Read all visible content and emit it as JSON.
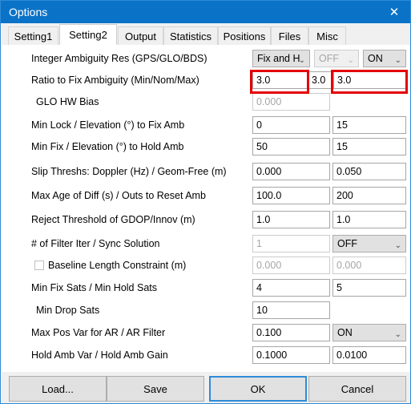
{
  "window": {
    "title": "Options",
    "close_icon": "close-icon"
  },
  "tabs": [
    {
      "label": "Setting1",
      "active": false
    },
    {
      "label": "Setting2",
      "active": true
    },
    {
      "label": "Output",
      "active": false
    },
    {
      "label": "Statistics",
      "active": false
    },
    {
      "label": "Positions",
      "active": false
    },
    {
      "label": "Files",
      "active": false
    },
    {
      "label": "Misc",
      "active": false
    }
  ],
  "settings": {
    "integer_ambiguity_res": {
      "label": "Integer Ambiguity Res (GPS/GLO/BDS)",
      "gps": "Fix and H",
      "glo": "OFF",
      "bds": "ON"
    },
    "ratio_to_fix": {
      "label": "Ratio to Fix Ambiguity (Min/Nom/Max)",
      "min": "3.0",
      "nom": "3.0",
      "max": "3.0"
    },
    "glo_hw_bias": {
      "label": "GLO HW Bias",
      "value": "0.000"
    },
    "min_lock_elev_fix": {
      "label": "Min Lock / Elevation (°) to Fix Amb",
      "min_lock": "0",
      "elevation": "15"
    },
    "min_fix_elev_hold": {
      "label": "Min Fix / Elevation (°) to Hold Amb",
      "min_fix": "50",
      "elevation": "15"
    },
    "slip_threshs": {
      "label": "Slip Threshs: Doppler (Hz) / Geom-Free (m)",
      "doppler": "0.000",
      "geom_free": "0.050"
    },
    "max_age_outs": {
      "label": "Max Age of Diff (s) / Outs to Reset Amb",
      "max_age": "100.0",
      "outs": "200"
    },
    "reject_threshold": {
      "label": "Reject Threshold of GDOP/Innov (m)",
      "gdop": "1.0",
      "innov": "1.0"
    },
    "filter_iter_sync": {
      "label": "# of Filter Iter / Sync Solution",
      "filter_iter": "1",
      "sync_solution": "OFF"
    },
    "baseline_length": {
      "label": "Baseline Length Constraint (m)",
      "checked": false,
      "length": "0.000",
      "sigma": "0.000"
    },
    "min_fix_hold_sats": {
      "label": "Min Fix Sats / Min Hold Sats",
      "min_fix_sats": "4",
      "min_hold_sats": "5"
    },
    "min_drop_sats": {
      "label": "Min Drop Sats",
      "value": "10"
    },
    "max_pos_var_ar": {
      "label": "Max Pos Var for AR  / AR Filter",
      "max_pos_var": "0.100",
      "ar_filter": "ON"
    },
    "hold_amb": {
      "label": "Hold Amb Var / Hold Amb Gain",
      "hold_amb_var": "0.1000",
      "hold_amb_gain": "0.0100"
    }
  },
  "footer": {
    "load": "Load...",
    "save": "Save",
    "ok": "OK",
    "cancel": "Cancel"
  },
  "annotations": {
    "highlight_color": "#e40000",
    "count": 2
  },
  "icons": {
    "caret": "⌄",
    "close": "✕"
  }
}
